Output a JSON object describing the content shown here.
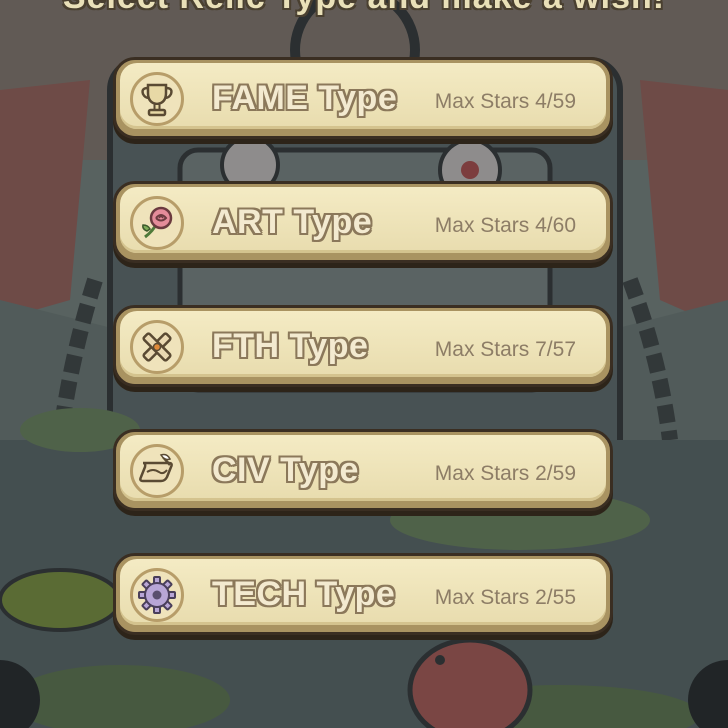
{
  "header": {
    "prompt": "Select Relic Type and make a wish!"
  },
  "relic_types": [
    {
      "label": "FAME Type",
      "stars": "Max Stars 4/59",
      "icon": "trophy-icon"
    },
    {
      "label": "ART Type",
      "stars": "Max Stars 4/60",
      "icon": "rose-icon"
    },
    {
      "label": "FTH Type",
      "stars": "Max Stars 7/57",
      "icon": "cross-icon"
    },
    {
      "label": "CIV Type",
      "stars": "Max Stars 2/59",
      "icon": "scroll-icon"
    },
    {
      "label": "TECH Type",
      "stars": "Max Stars 2/55",
      "icon": "gear-icon"
    }
  ],
  "colors": {
    "card": "#f4ebc4",
    "card_border": "#3a2e22",
    "label_outline": "#8b785a",
    "stars_text": "#8d7d66"
  }
}
